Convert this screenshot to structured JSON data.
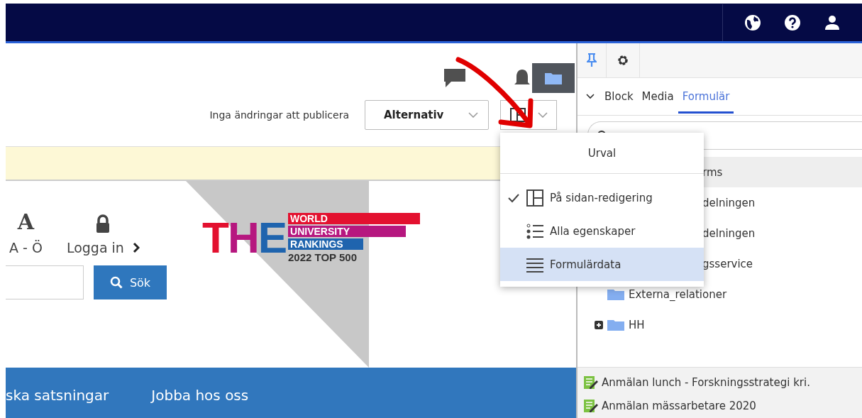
{
  "toolbar": {
    "status": "Inga ändringar att publicera",
    "options_dropdown": {
      "value": "Alternativ"
    }
  },
  "site": {
    "quick_links": [
      {
        "glyph": "A",
        "label": "A - Ö"
      },
      {
        "label": "Logga in"
      }
    ],
    "search_button": "Sök",
    "badge": {
      "big": "THE",
      "lines": [
        "WORLD",
        "UNIVERSITY",
        "RANKINGS"
      ],
      "subtitle": "2022 TOP 500"
    },
    "nav": [
      "ska satsningar",
      "Jobba hos oss"
    ]
  },
  "panel": {
    "tabs": [
      {
        "label": "Block",
        "selected": false
      },
      {
        "label": "Media",
        "selected": false
      },
      {
        "label": "Formulär",
        "selected": true
      }
    ],
    "tree": [
      {
        "label": "rms",
        "selected": true,
        "covered": true
      },
      {
        "label": "delningen",
        "selected": false,
        "covered": true
      },
      {
        "label": "delningen",
        "selected": false,
        "covered": true
      },
      {
        "label": "gsservice",
        "selected": false,
        "covered": true
      },
      {
        "label": "Externa_relationer",
        "selected": false,
        "expandable": false,
        "covered": false
      },
      {
        "label": "HH",
        "selected": false,
        "expandable": true,
        "covered": false
      }
    ],
    "forms": [
      "Anmälan lunch - Forskningsstrategi kri.",
      "Anmälan mässarbetare 2020"
    ]
  },
  "view_menu": {
    "title": "Urval",
    "items": [
      {
        "label": "På sidan-redigering",
        "kind": "layout",
        "checked": true,
        "selected": false
      },
      {
        "label": "Alla egenskaper",
        "kind": "list",
        "checked": false,
        "selected": false
      },
      {
        "label": "Formulärdata",
        "kind": "lines",
        "checked": false,
        "selected": true
      }
    ]
  }
}
